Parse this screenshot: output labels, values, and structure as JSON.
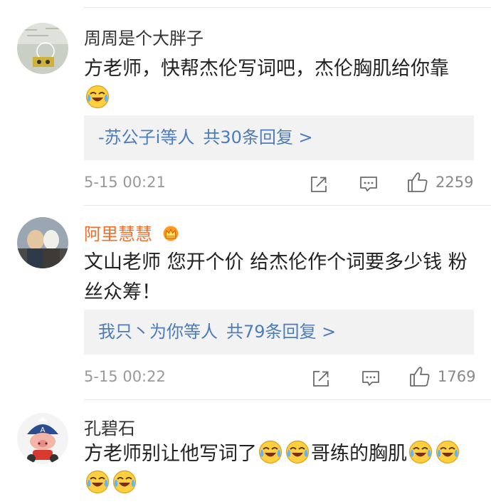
{
  "comments": [
    {
      "username": "周周是个大胖子",
      "text": "方老师，快帮杰伦写词吧，杰伦胸肌给你靠",
      "reply_users": "-苏公子i等人",
      "reply_count": "共30条回复 >",
      "time": "5-15 00:21",
      "likes": "2259"
    },
    {
      "username": "阿里慧慧",
      "text": "文山老师 您开个价 给杰伦作个词要多少钱 粉丝众筹！",
      "reply_users": "我只丶为你等人",
      "reply_count": "共79条回复 >",
      "time": "5-15 00:22",
      "likes": "1769"
    },
    {
      "username": "孔碧石",
      "text_a": "方老师别让他写词了",
      "text_b": "哥练的胸肌"
    }
  ],
  "icons": {
    "share": "share-icon",
    "comment": "comment-icon",
    "like": "thumbs-up-icon",
    "emoji": "laugh-cry-emoji",
    "vip": "crown-vip-icon"
  },
  "colors": {
    "link": "#4d7cbb",
    "vip_name": "#f26d28",
    "meta": "#999999"
  }
}
